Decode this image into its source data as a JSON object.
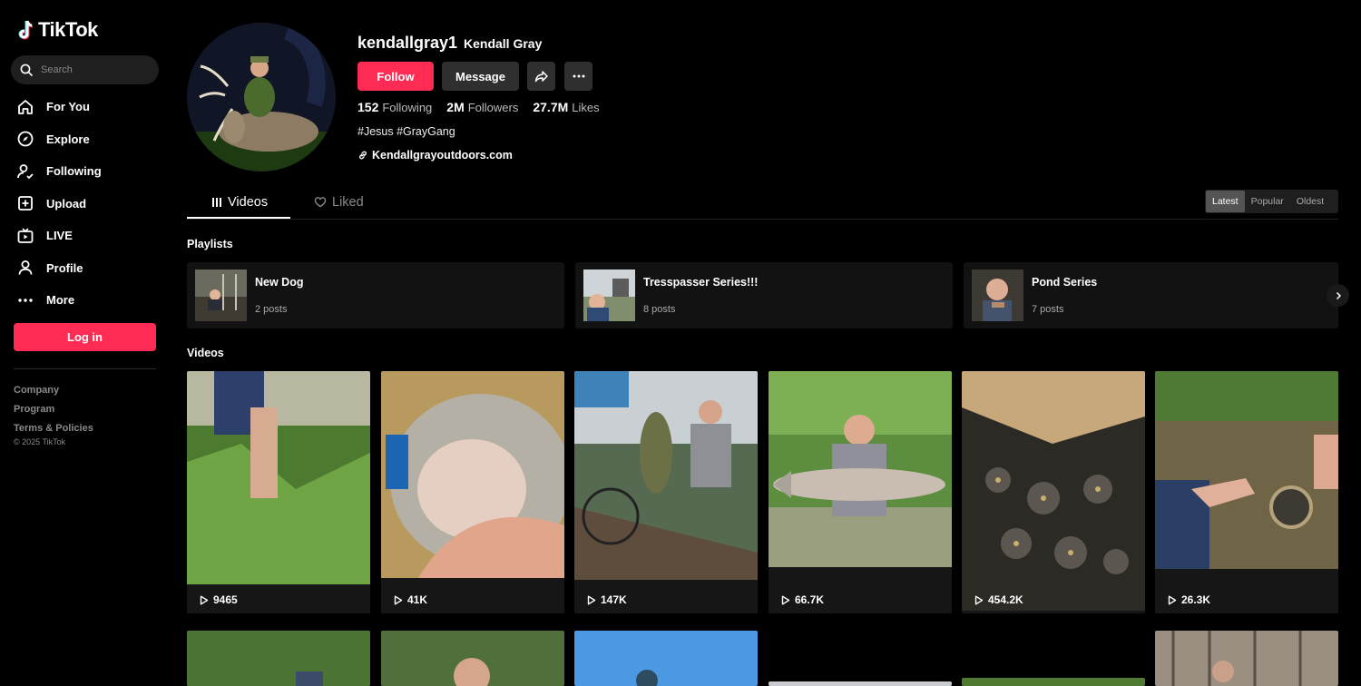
{
  "brand": {
    "name": "TikTok",
    "accent": "#fe2c55"
  },
  "search": {
    "placeholder": "Search"
  },
  "nav": [
    {
      "label": "For You",
      "icon": "home-icon"
    },
    {
      "label": "Explore",
      "icon": "compass-icon"
    },
    {
      "label": "Following",
      "icon": "following-icon"
    },
    {
      "label": "Upload",
      "icon": "upload-icon"
    },
    {
      "label": "LIVE",
      "icon": "live-icon"
    },
    {
      "label": "Profile",
      "icon": "profile-icon"
    },
    {
      "label": "More",
      "icon": "more-icon"
    }
  ],
  "login_label": "Log in",
  "footer": {
    "company": "Company",
    "program": "Program",
    "terms": "Terms & Policies",
    "copyright": "© 2025 TikTok"
  },
  "profile": {
    "username": "kendallgray1",
    "display_name": "Kendall Gray",
    "follow_label": "Follow",
    "message_label": "Message",
    "stats": [
      {
        "value": "152",
        "label": "Following"
      },
      {
        "value": "2M",
        "label": "Followers"
      },
      {
        "value": "27.7M",
        "label": "Likes"
      }
    ],
    "bio": "#Jesus #GrayGang",
    "link": "Kendallgrayoutdoors.com"
  },
  "tabs": [
    {
      "label": "Videos"
    },
    {
      "label": "Liked"
    }
  ],
  "sort": [
    "Latest",
    "Popular",
    "Oldest"
  ],
  "playlists_heading": "Playlists",
  "playlists": [
    {
      "title": "New Dog",
      "posts": "2 posts"
    },
    {
      "title": "Tresspasser Series!!!",
      "posts": "8 posts"
    },
    {
      "title": "Pond Series",
      "posts": "7 posts"
    }
  ],
  "videos_heading": "Videos",
  "videos": [
    {
      "views": "9465"
    },
    {
      "views": "41K"
    },
    {
      "views": "147K"
    },
    {
      "views": "66.7K"
    },
    {
      "views": "454.2K"
    },
    {
      "views": "26.3K"
    }
  ]
}
